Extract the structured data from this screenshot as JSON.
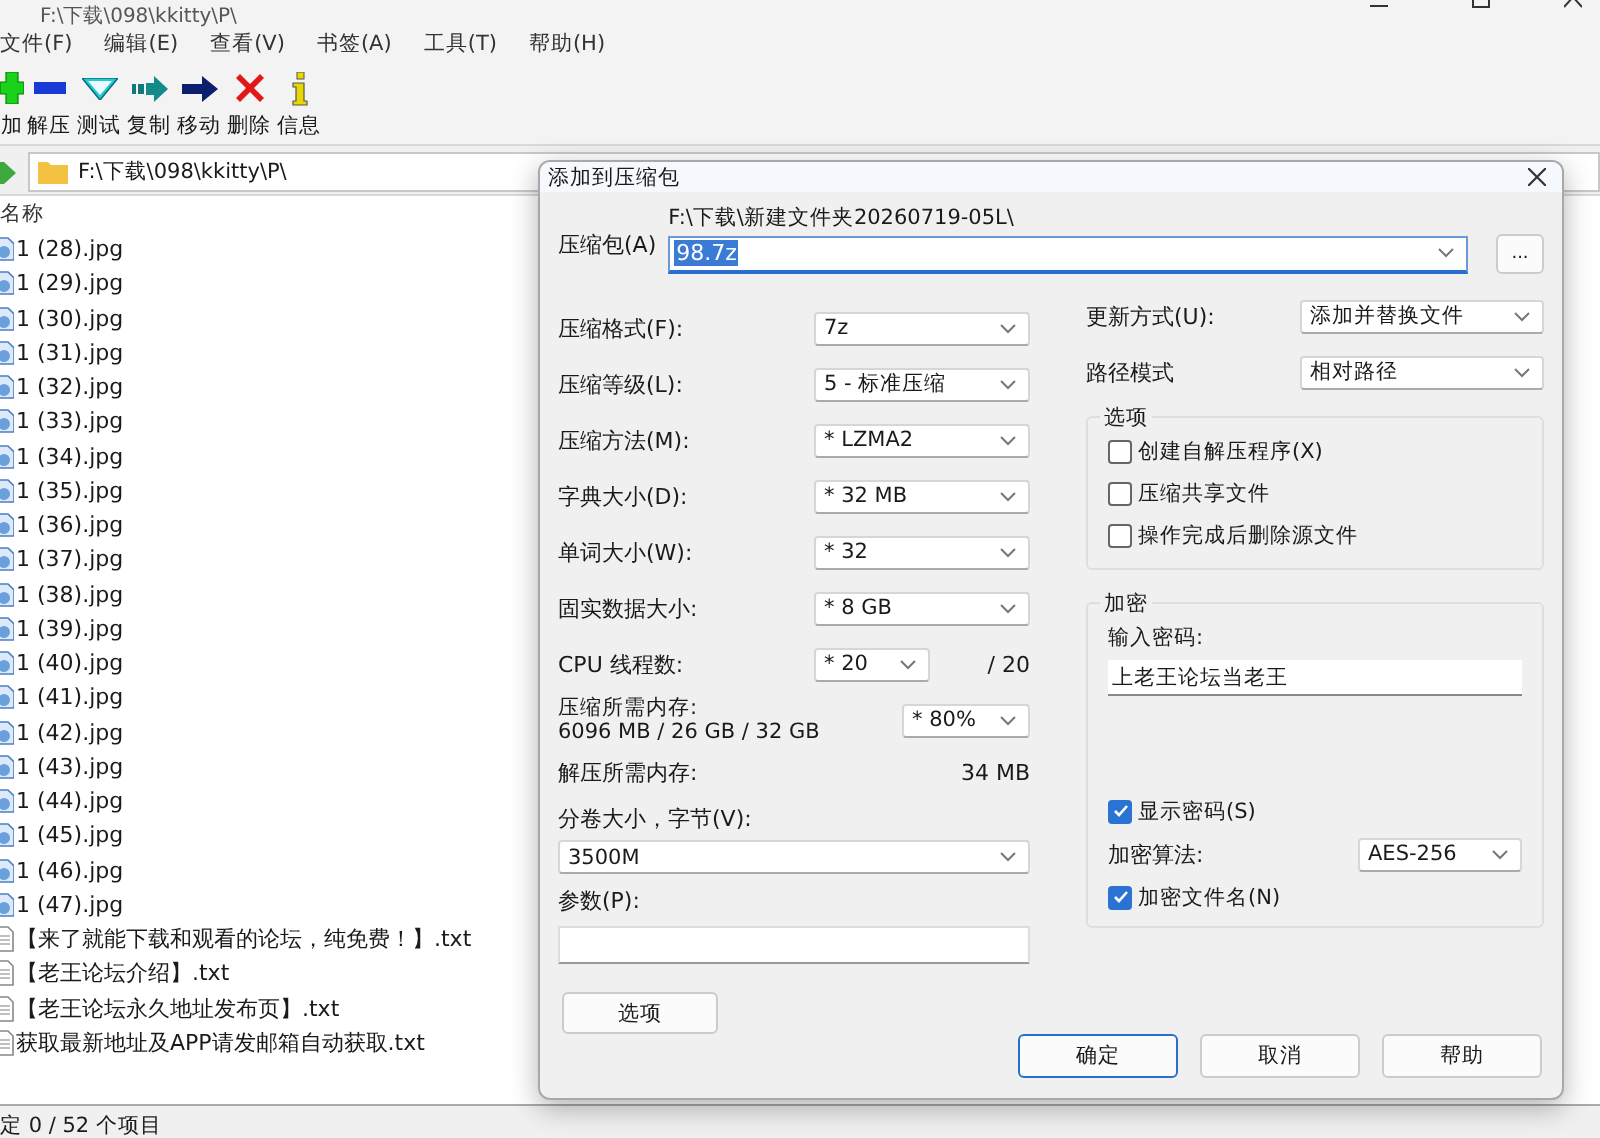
{
  "window": {
    "title": "F:\\下载\\098\\kkitty\\P\\"
  },
  "menu": [
    "文件(F)",
    "编辑(E)",
    "查看(V)",
    "书签(A)",
    "工具(T)",
    "帮助(H)"
  ],
  "toolbar": [
    {
      "label": "加",
      "kind": "add"
    },
    {
      "label": "解压",
      "kind": "extract"
    },
    {
      "label": "测试",
      "kind": "test"
    },
    {
      "label": "复制",
      "kind": "copy"
    },
    {
      "label": "移动",
      "kind": "move"
    },
    {
      "label": "删除",
      "kind": "delete"
    },
    {
      "label": "信息",
      "kind": "info"
    }
  ],
  "address": {
    "path": "F:\\下载\\098\\kkitty\\P\\"
  },
  "list": {
    "column": "名称",
    "rows": [
      {
        "name": "1 (28).jpg",
        "kind": "image"
      },
      {
        "name": "1 (29).jpg",
        "kind": "image"
      },
      {
        "name": "1 (30).jpg",
        "kind": "image"
      },
      {
        "name": "1 (31).jpg",
        "kind": "image"
      },
      {
        "name": "1 (32).jpg",
        "kind": "image"
      },
      {
        "name": "1 (33).jpg",
        "kind": "image"
      },
      {
        "name": "1 (34).jpg",
        "kind": "image"
      },
      {
        "name": "1 (35).jpg",
        "kind": "image"
      },
      {
        "name": "1 (36).jpg",
        "kind": "image"
      },
      {
        "name": "1 (37).jpg",
        "kind": "image"
      },
      {
        "name": "1 (38).jpg",
        "kind": "image"
      },
      {
        "name": "1 (39).jpg",
        "kind": "image"
      },
      {
        "name": "1 (40).jpg",
        "kind": "image"
      },
      {
        "name": "1 (41).jpg",
        "kind": "image"
      },
      {
        "name": "1 (42).jpg",
        "kind": "image"
      },
      {
        "name": "1 (43).jpg",
        "kind": "image"
      },
      {
        "name": "1 (44).jpg",
        "kind": "image"
      },
      {
        "name": "1 (45).jpg",
        "kind": "image"
      },
      {
        "name": "1 (46).jpg",
        "kind": "image"
      },
      {
        "name": "1 (47).jpg",
        "kind": "image"
      },
      {
        "name": "【来了就能下载和观看的论坛，纯免费！】.txt",
        "kind": "text"
      },
      {
        "name": "【老王论坛介绍】.txt",
        "kind": "text"
      },
      {
        "name": "【老王论坛永久地址发布页】.txt",
        "kind": "text"
      },
      {
        "name": "获取最新地址及APP请发邮箱自动获取.txt",
        "kind": "text"
      }
    ]
  },
  "status_bar": "定 0 / 52 个项目",
  "dialog": {
    "title": "添加到压缩包",
    "archive": {
      "label": "压缩包(A)",
      "folder": "F:\\下载\\新建文件夹20260719-05L\\",
      "value": "98.7z",
      "text_selected": true,
      "browse": "..."
    },
    "left_fields": [
      {
        "label": "压缩格式(F):",
        "value": "7z"
      },
      {
        "label": "压缩等级(L):",
        "value": "5 - 标准压缩"
      },
      {
        "label": "压缩方法(M):",
        "value": "* LZMA2"
      },
      {
        "label": "字典大小(D):",
        "value": "* 32 MB"
      },
      {
        "label": "单词大小(W):",
        "value": "* 32"
      },
      {
        "label": "固实数据大小:",
        "value": "* 8 GB"
      }
    ],
    "cpu": {
      "label": "CPU 线程数:",
      "value": "* 20",
      "total": "/ 20"
    },
    "memory": {
      "label": "压缩所需内存:",
      "detail": "6096 MB / 26 GB / 32 GB",
      "value": "* 80%"
    },
    "decompress_memory": {
      "label": "解压所需内存:",
      "value": "34 MB"
    },
    "volume": {
      "label": "分卷大小，字节(V):",
      "value": "3500M"
    },
    "parameters": {
      "label": "参数(P):"
    },
    "options_button": "选项",
    "update_mode": {
      "label": "更新方式(U):",
      "value": "添加并替换文件"
    },
    "path_mode": {
      "label": "路径模式",
      "value": "相对路径"
    },
    "options": {
      "title": "选项",
      "items": [
        {
          "label": "创建自解压程序(X)",
          "checked": false
        },
        {
          "label": "压缩共享文件",
          "checked": false
        },
        {
          "label": "操作完成后删除源文件",
          "checked": false
        }
      ]
    },
    "encryption": {
      "title": "加密",
      "password_label": "输入密码:",
      "password": "上老王论坛当老王",
      "show_password": {
        "label": "显示密码(S)",
        "checked": true
      },
      "method": {
        "label": "加密算法:",
        "value": "AES-256"
      },
      "encrypt_names": {
        "label": "加密文件名(N)",
        "checked": true
      }
    },
    "buttons": [
      {
        "label": "确定",
        "default": true
      },
      {
        "label": "取消",
        "default": false
      },
      {
        "label": "帮助",
        "default": false
      }
    ]
  }
}
